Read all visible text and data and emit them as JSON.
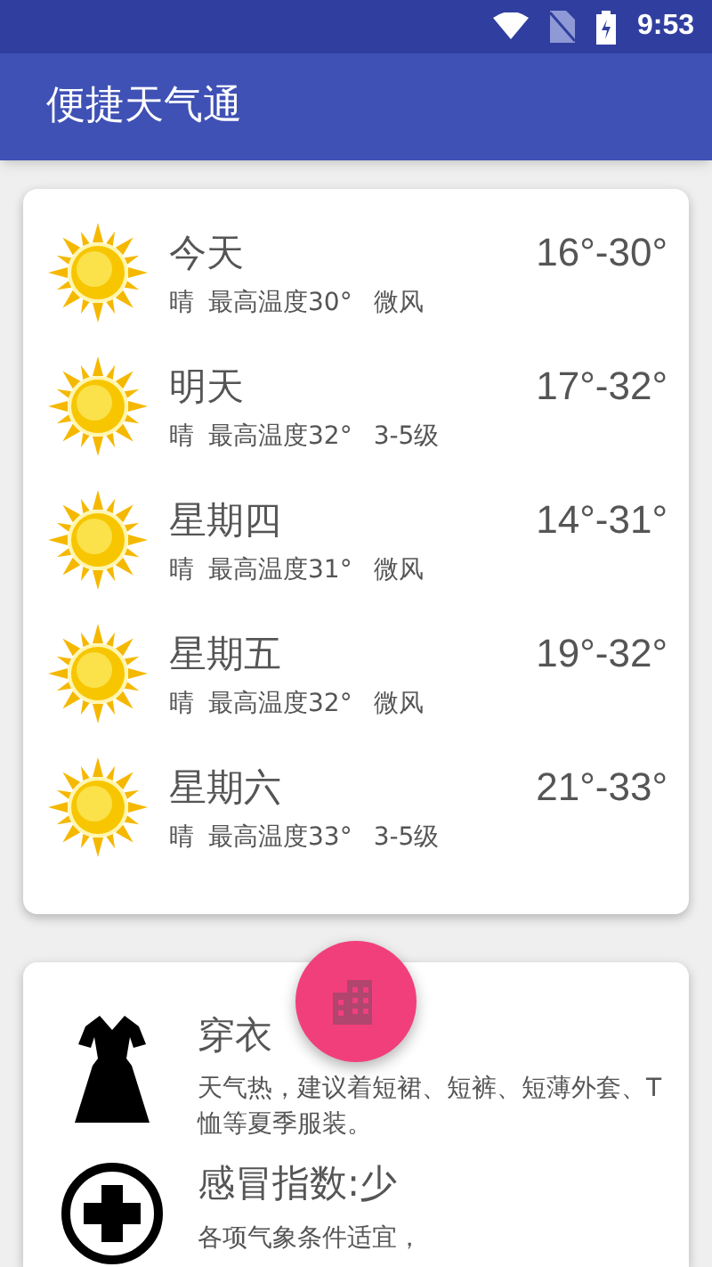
{
  "status_bar": {
    "time": "9:53"
  },
  "app_bar": {
    "title": "便捷天气通"
  },
  "forecast": [
    {
      "day": "今天",
      "range": "16°-30°",
      "condition": "晴",
      "high": "最高温度30°",
      "wind": "微风"
    },
    {
      "day": "明天",
      "range": "17°-32°",
      "condition": "晴",
      "high": "最高温度32°",
      "wind": "3-5级"
    },
    {
      "day": "星期四",
      "range": "14°-31°",
      "condition": "晴",
      "high": "最高温度31°",
      "wind": "微风"
    },
    {
      "day": "星期五",
      "range": "19°-32°",
      "condition": "晴",
      "high": "最高温度32°",
      "wind": "微风"
    },
    {
      "day": "星期六",
      "range": "21°-33°",
      "condition": "晴",
      "high": "最高温度33°",
      "wind": "3-5级"
    }
  ],
  "indices": [
    {
      "kind": "dress",
      "title": "穿衣",
      "text": "天气热，建议着短裙、短裤、短薄外套、T恤等夏季服装。"
    },
    {
      "kind": "cold",
      "title": "感冒指数:少",
      "text": "各项气象条件适宜，"
    }
  ]
}
